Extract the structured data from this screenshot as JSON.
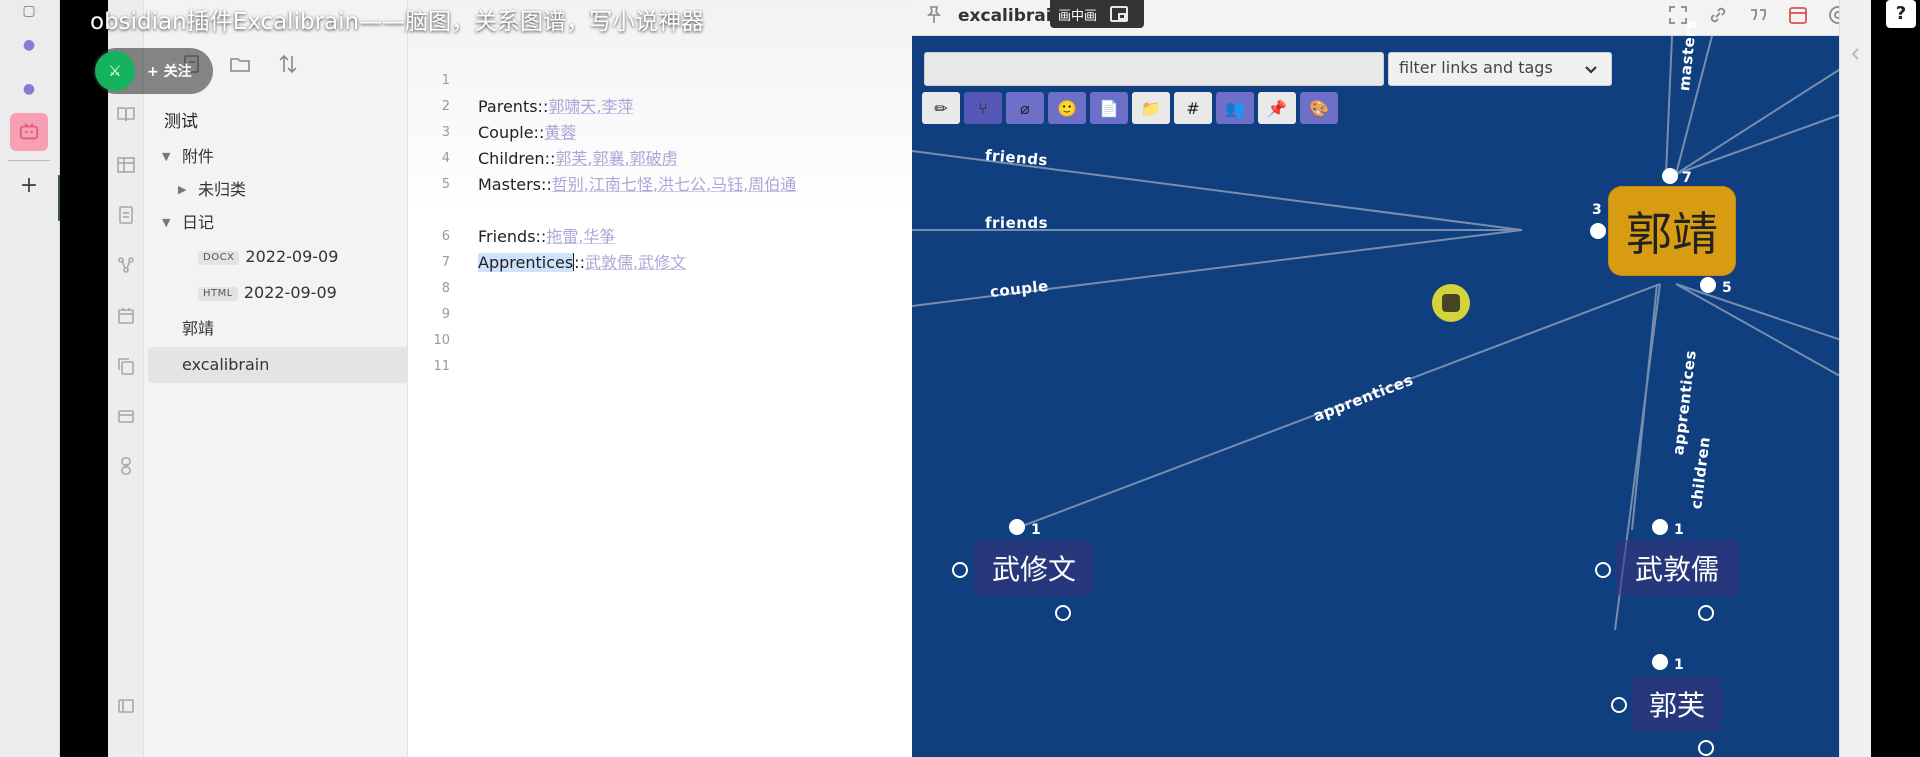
{
  "video": {
    "title": "obsidian插件Excalibrain——脑图，关系图谱，写小说神器",
    "follow_label": "+ 关注",
    "pip_label": "画中画"
  },
  "file_explorer": {
    "vault_name": "测试",
    "items": [
      {
        "label": "附件",
        "type": "folder",
        "expanded": true
      },
      {
        "label": "未归类",
        "type": "folder",
        "expanded": false
      },
      {
        "label": "日记",
        "type": "folder",
        "expanded": true
      },
      {
        "label": "2022-09-09",
        "ext": "DOCX",
        "type": "file"
      },
      {
        "label": "2022-09-09",
        "ext": "HTML",
        "type": "file"
      },
      {
        "label": "郭靖",
        "type": "file"
      },
      {
        "label": "excalibrain",
        "type": "file",
        "selected": true
      }
    ]
  },
  "editor": {
    "line_numbers": [
      "1",
      "2",
      "3",
      "4",
      "5",
      "6",
      "7",
      "8",
      "9",
      "10",
      "11"
    ],
    "lines": [
      {
        "key": "",
        "values": []
      },
      {
        "key": "Parents::",
        "values": [
          "郭啸天",
          "李萍"
        ]
      },
      {
        "key": "Couple::",
        "values": [
          "黄蓉"
        ]
      },
      {
        "key": "Children::",
        "values": [
          "郭芙",
          "郭襄",
          "郭破虏"
        ]
      },
      {
        "key": "Masters::",
        "values": [
          "哲别",
          "江南七怪",
          "洪七公",
          "马钰",
          "周伯通"
        ]
      },
      {
        "key": "Friends::",
        "values": [
          "拖雷",
          "华筝"
        ]
      },
      {
        "key": "Apprentices",
        "suffix": "::",
        "values": [
          "武敦儒",
          "武修文"
        ]
      }
    ]
  },
  "graph": {
    "tab_title": "excalibrain",
    "search_placeholder": "",
    "filter_label": "filter links and tags",
    "toolbar": [
      "✏",
      "⑂",
      "⌀",
      "🙂",
      "📄",
      "📁",
      "#",
      "👥",
      "📌",
      "🎨"
    ],
    "central_node": {
      "label": "郭靖",
      "count_top": "7",
      "count_left": "3",
      "count_bottom": "5"
    },
    "nodes": [
      {
        "label": "武修文",
        "count": "1"
      },
      {
        "label": "武敦儒",
        "count": "1"
      },
      {
        "label": "郭芙",
        "count": "1"
      }
    ],
    "edge_labels": [
      "friends",
      "friends",
      "couple",
      "apprentices",
      "apprentices",
      "children",
      "masters"
    ]
  }
}
